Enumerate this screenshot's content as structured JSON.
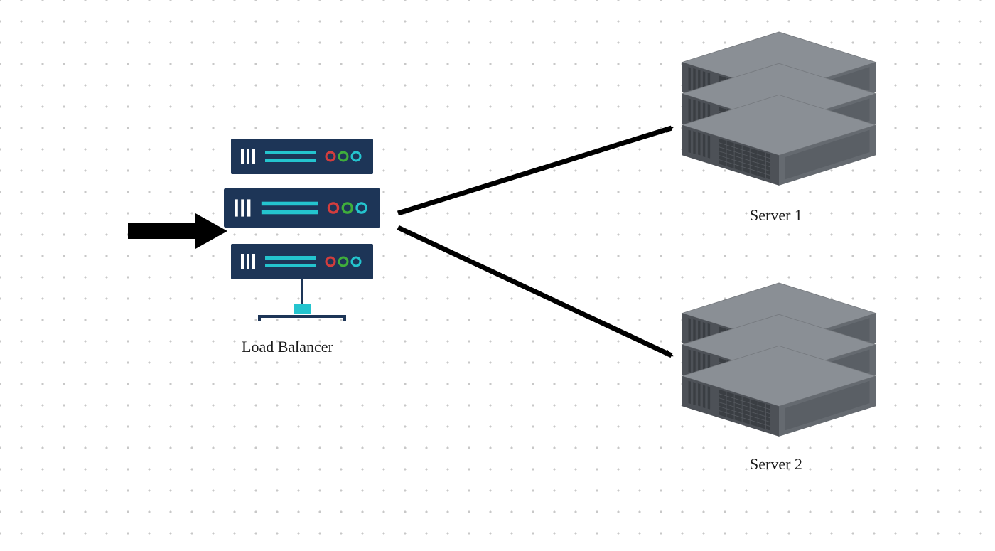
{
  "nodes": {
    "loadBalancer": {
      "label": "Load Balancer"
    },
    "server1": {
      "label": "Server 1"
    },
    "server2": {
      "label": "Server 2"
    }
  },
  "colors": {
    "rackBody": "#1d3557",
    "rackAccent": "#24c4ce",
    "ledRed": "#d33d3d",
    "ledGreen": "#3fae3b",
    "ledCyan": "#24c4ce",
    "serverTop": "#8a8f95",
    "serverTopDark": "#6d7278",
    "serverLeft": "#4d5157",
    "serverRight": "#656a70",
    "serverRightDark": "#55595f",
    "grill": "#3a3e43",
    "arrow": "#000000"
  }
}
